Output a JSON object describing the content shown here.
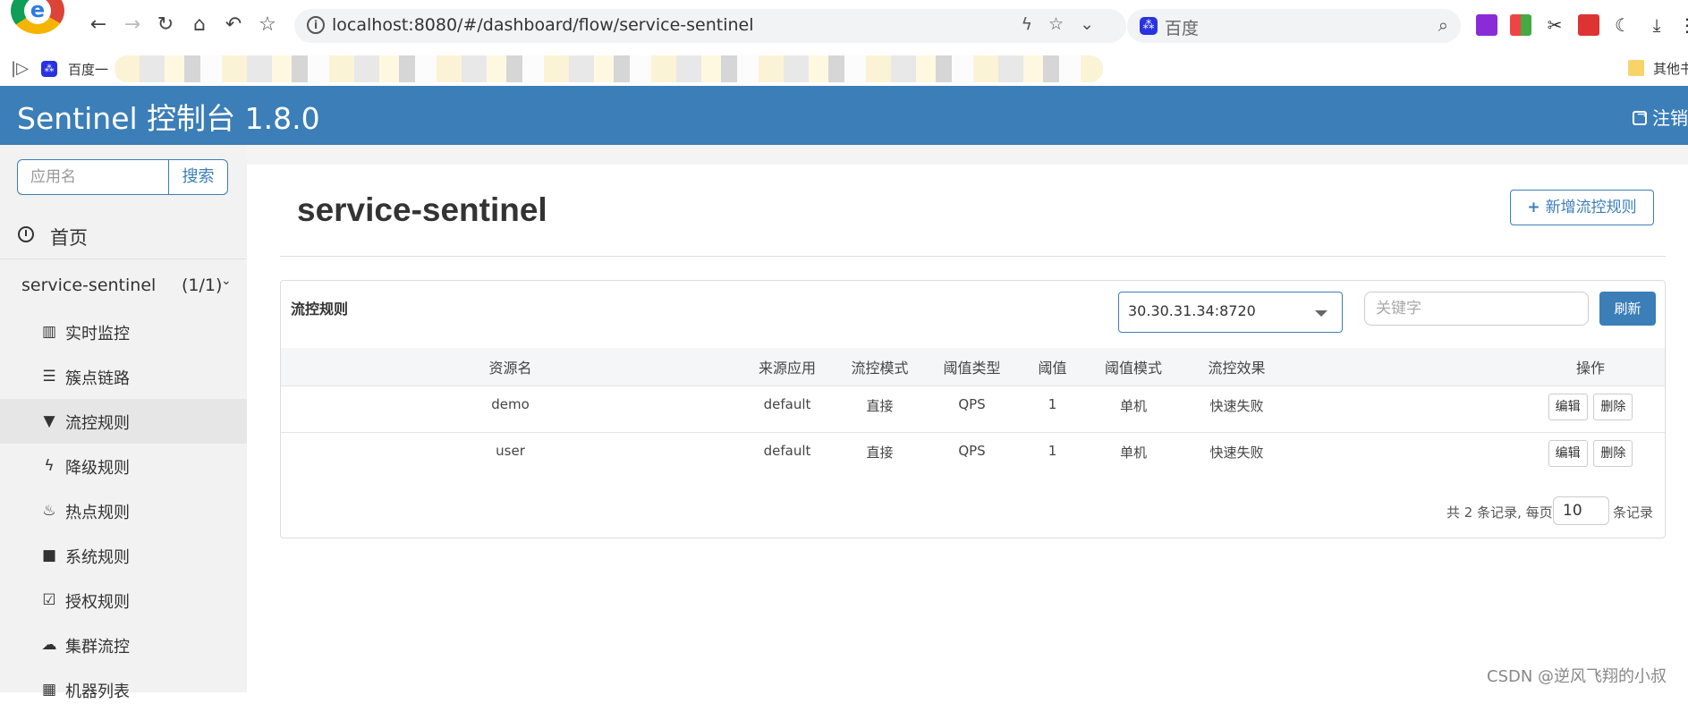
{
  "browser": {
    "url": "localhost:8080/#/dashboard/flow/service-sentinel",
    "search_engine": "百度",
    "bookmark_first": "百度一",
    "bookmark_other": "其他书"
  },
  "header": {
    "title": "Sentinel 控制台 1.8.0",
    "logout": "注销"
  },
  "sidebar": {
    "search_placeholder": "应用名",
    "search_button": "搜索",
    "home": "首页",
    "app_name": "service-sentinel",
    "app_count": "(1/1)",
    "items": [
      {
        "label": "实时监控",
        "icon": "bar-chart-icon"
      },
      {
        "label": "簇点链路",
        "icon": "list-icon"
      },
      {
        "label": "流控规则",
        "icon": "filter-icon",
        "active": true
      },
      {
        "label": "降级规则",
        "icon": "flash-icon"
      },
      {
        "label": "热点规则",
        "icon": "fire-icon"
      },
      {
        "label": "系统规则",
        "icon": "lock-icon"
      },
      {
        "label": "授权规则",
        "icon": "check-icon"
      },
      {
        "label": "集群流控",
        "icon": "cloud-icon"
      },
      {
        "label": "机器列表",
        "icon": "grid-icon"
      }
    ]
  },
  "main": {
    "page_title": "service-sentinel",
    "add_button": "新增流控规则",
    "panel_title": "流控规则",
    "machine": "30.30.31.34:8720",
    "keyword_placeholder": "关键字",
    "refresh": "刷新",
    "columns": [
      "资源名",
      "来源应用",
      "流控模式",
      "阈值类型",
      "阈值",
      "阈值模式",
      "流控效果",
      "操作"
    ],
    "rows": [
      {
        "resource": "demo",
        "origin": "default",
        "mode": "直接",
        "grade": "QPS",
        "threshold": "1",
        "cluster": "单机",
        "effect": "快速失败",
        "edit": "编辑",
        "delete": "删除"
      },
      {
        "resource": "user",
        "origin": "default",
        "mode": "直接",
        "grade": "QPS",
        "threshold": "1",
        "cluster": "单机",
        "effect": "快速失败",
        "edit": "编辑",
        "delete": "删除"
      }
    ],
    "pagination": {
      "total_text": "共 2 条记录, 每页",
      "page_size": "10",
      "suffix": "条记录"
    }
  },
  "watermark": "CSDN @逆风飞翔的小叔"
}
